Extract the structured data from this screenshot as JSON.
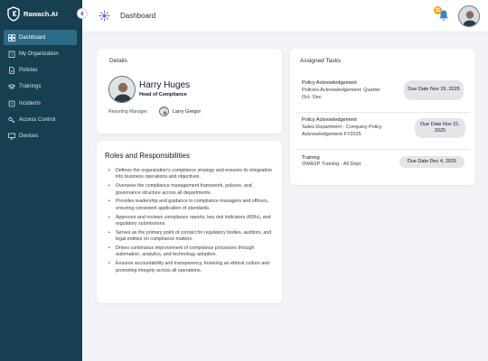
{
  "brand": {
    "name": "Rawach.AI"
  },
  "header": {
    "title": "Dashboard",
    "notification_count": "31"
  },
  "sidebar": {
    "items": [
      {
        "label": "Dashboard",
        "icon": "grid-icon",
        "active": true
      },
      {
        "label": "My Organization",
        "icon": "building-icon",
        "active": false
      },
      {
        "label": "Policies",
        "icon": "document-icon",
        "active": false
      },
      {
        "label": "Trainings",
        "icon": "graduation-icon",
        "active": false
      },
      {
        "label": "Incidents",
        "icon": "alert-icon",
        "active": false
      },
      {
        "label": "Access Control",
        "icon": "key-icon",
        "active": false
      },
      {
        "label": "Devices",
        "icon": "monitor-icon",
        "active": false
      }
    ]
  },
  "details": {
    "title": "Details",
    "name": "Harry Huges",
    "role": "Head of Compliance",
    "manager_label": "Reporting Manager:",
    "manager_name": "Larry Gregor"
  },
  "roles": {
    "title": "Roles and Responsibilities",
    "items": [
      "Defines the organization's compliance strategy and ensures its integration into business operations and objectives.",
      "Oversees the compliance management framework, policies, and governance structure across all departments.",
      "Provides leadership and guidance to compliance managers and officers, ensuring consistent application of standards.",
      "Approves and reviews compliance reports, key risk indicators (KRIs), and regulatory submissions.",
      "Serves as the primary point of contact for regulatory bodies, auditors, and legal entities on compliance matters.",
      "Drives continuous improvement of compliance processes through automation, analytics, and technology adoption.",
      "Ensures accountability and transparency, fostering an ethical culture and promoting integrity across all operations."
    ]
  },
  "tasks": {
    "title": "Assigned Tasks",
    "items": [
      {
        "type": "Policy Acknowledgement",
        "desc": "Policies Acknowledgement: Quarter Oct- Dec",
        "due": "Due Date Nov 29, 2025"
      },
      {
        "type": "Policy Acknowledgement",
        "desc": "Sales Department - Company Policy Acknowledgement FY2025",
        "due": "Due Date Nov 21, 2025"
      },
      {
        "type": "Training",
        "desc": "OWASP Training - All Dept",
        "due": "Due Date Dec 4, 2025"
      }
    ]
  },
  "colors": {
    "sidebar_bg": "#173f52",
    "active_item": "#2c6b86",
    "badge": "#f3a51c",
    "page_bg": "#f1f3f6"
  }
}
